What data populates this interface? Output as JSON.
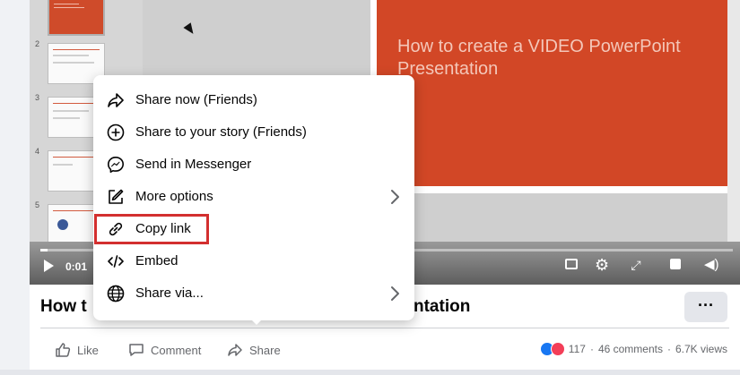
{
  "player": {
    "slide_numbers": [
      "2",
      "3",
      "4",
      "5"
    ],
    "slide_title": "How to create a VIDEO PowerPoint Presentation",
    "current_time": "0:01",
    "progress_fraction": 0.01
  },
  "post": {
    "title_visible_left": "How t",
    "title_visible_right": "ntation",
    "more_label": "···"
  },
  "actions": {
    "like": "Like",
    "comment": "Comment",
    "share": "Share"
  },
  "stats": {
    "reactions": "117",
    "comments": "46 comments",
    "views": "6.7K views",
    "separator": "·"
  },
  "share_menu": {
    "items": [
      {
        "label": "Share now (Friends)",
        "icon": "share-arrow-icon"
      },
      {
        "label": "Share to your story (Friends)",
        "icon": "plus-circle-icon"
      },
      {
        "label": "Send in Messenger",
        "icon": "messenger-icon"
      },
      {
        "label": "More options",
        "icon": "edit-icon"
      },
      {
        "label": "Copy link",
        "icon": "link-icon"
      },
      {
        "label": "Embed",
        "icon": "code-icon"
      },
      {
        "label": "Share via...",
        "icon": "globe-icon"
      }
    ],
    "highlighted_item": "Copy link"
  },
  "colors": {
    "slide_red": "#d24726",
    "highlight_red": "#d32f2f",
    "like_blue": "#1877f2",
    "love_red": "#f33e58"
  }
}
